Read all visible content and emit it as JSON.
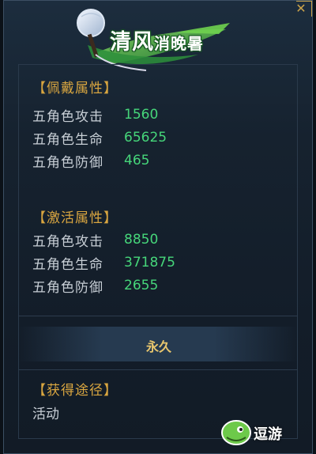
{
  "badge": {
    "title_main": "清风",
    "title_sub": "消晚暑"
  },
  "equip_section": {
    "header": "【佩戴属性】",
    "stats": [
      {
        "label": "五角色攻击",
        "value": "1560"
      },
      {
        "label": "五角色生命",
        "value": "65625"
      },
      {
        "label": "五角色防御",
        "value": "465"
      }
    ]
  },
  "activate_section": {
    "header": "【激活属性】",
    "stats": [
      {
        "label": "五角色攻击",
        "value": "8850"
      },
      {
        "label": "五角色生命",
        "value": "371875"
      },
      {
        "label": "五角色防御",
        "value": "2655"
      }
    ]
  },
  "duration": "永久",
  "source_section": {
    "header": "【获得途径】",
    "text": "活动"
  },
  "logo": {
    "text": "逗游"
  },
  "icons": {
    "close": "close-icon",
    "fan": "fan-icon",
    "leaf": "leaf-icon",
    "logo": "logo-icon"
  },
  "colors": {
    "header": "#d9a640",
    "value_green": "#46d67a",
    "label": "#c8cfd6",
    "duration": "#e8c66e"
  }
}
